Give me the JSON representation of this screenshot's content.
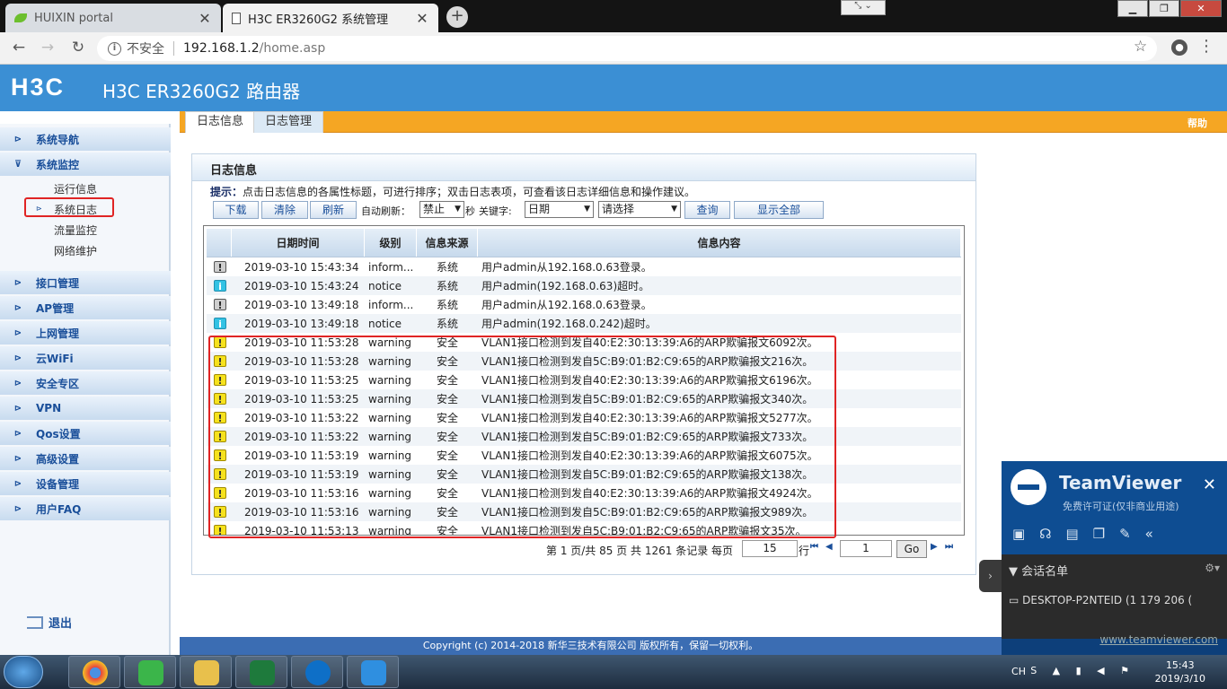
{
  "browser": {
    "tabs": [
      {
        "title": "HUIXIN portal",
        "icon": "leaf-icon"
      },
      {
        "title": "H3C ER3260G2 系统管理",
        "icon": "document-icon"
      }
    ],
    "new_tab": "+",
    "insecure_label": "不安全",
    "url_host": "192.168.1.2",
    "url_path": "/home.asp"
  },
  "app": {
    "logo": "H3C",
    "title": "H3C ER3260G2 路由器"
  },
  "sidebar": {
    "items": [
      {
        "label": "系统导航"
      },
      {
        "label": "系统监控"
      },
      {
        "label": "接口管理"
      },
      {
        "label": "AP管理"
      },
      {
        "label": "上网管理"
      },
      {
        "label": "云WiFi"
      },
      {
        "label": "安全专区"
      },
      {
        "label": "VPN"
      },
      {
        "label": "Qos设置"
      },
      {
        "label": "高级设置"
      },
      {
        "label": "设备管理"
      },
      {
        "label": "用户FAQ"
      }
    ],
    "subitems": [
      {
        "label": "运行信息"
      },
      {
        "label": "系统日志"
      },
      {
        "label": "流量监控"
      },
      {
        "label": "网络维护"
      }
    ],
    "logout": "退出"
  },
  "content_tabs": [
    {
      "label": "日志信息"
    },
    {
      "label": "日志管理"
    }
  ],
  "help": "帮助",
  "panel": {
    "title": "日志信息",
    "hint_label": "提示：",
    "hint_text": "点击日志信息的各属性标题，可进行排序；双击日志表项，可查看该日志详细信息和操作建议。"
  },
  "toolbar": {
    "download": "下载",
    "clear": "清除",
    "refresh": "刷新",
    "auto_refresh_label": "自动刷新：",
    "auto_refresh_value": "禁止",
    "seconds_label": "秒",
    "keyword_label": "关键字:",
    "keyword_field": "日期",
    "keyword_value": "请选择",
    "query": "查询",
    "show_all": "显示全部"
  },
  "table": {
    "headers": [
      "日期时间",
      "级别",
      "信息来源",
      "信息内容"
    ],
    "rows": [
      {
        "level_icon": "info",
        "datetime": "2019-03-10 15:43:34",
        "level": "inform...",
        "source": "系统",
        "content": "用户admin从192.168.0.63登录。"
      },
      {
        "level_icon": "notice",
        "datetime": "2019-03-10 15:43:24",
        "level": "notice",
        "source": "系统",
        "content": "用户admin(192.168.0.63)超时。"
      },
      {
        "level_icon": "info",
        "datetime": "2019-03-10 13:49:18",
        "level": "inform...",
        "source": "系统",
        "content": "用户admin从192.168.0.63登录。"
      },
      {
        "level_icon": "notice",
        "datetime": "2019-03-10 13:49:18",
        "level": "notice",
        "source": "系统",
        "content": "用户admin(192.168.0.242)超时。"
      },
      {
        "level_icon": "warning",
        "datetime": "2019-03-10 11:53:28",
        "level": "warning",
        "source": "安全",
        "content": "VLAN1接口检测到发自40:E2:30:13:39:A6的ARP欺骗报文6092次。"
      },
      {
        "level_icon": "warning",
        "datetime": "2019-03-10 11:53:28",
        "level": "warning",
        "source": "安全",
        "content": "VLAN1接口检测到发自5C:B9:01:B2:C9:65的ARP欺骗报文216次。"
      },
      {
        "level_icon": "warning",
        "datetime": "2019-03-10 11:53:25",
        "level": "warning",
        "source": "安全",
        "content": "VLAN1接口检测到发自40:E2:30:13:39:A6的ARP欺骗报文6196次。"
      },
      {
        "level_icon": "warning",
        "datetime": "2019-03-10 11:53:25",
        "level": "warning",
        "source": "安全",
        "content": "VLAN1接口检测到发自5C:B9:01:B2:C9:65的ARP欺骗报文340次。"
      },
      {
        "level_icon": "warning",
        "datetime": "2019-03-10 11:53:22",
        "level": "warning",
        "source": "安全",
        "content": "VLAN1接口检测到发自40:E2:30:13:39:A6的ARP欺骗报文5277次。"
      },
      {
        "level_icon": "warning",
        "datetime": "2019-03-10 11:53:22",
        "level": "warning",
        "source": "安全",
        "content": "VLAN1接口检测到发自5C:B9:01:B2:C9:65的ARP欺骗报文733次。"
      },
      {
        "level_icon": "warning",
        "datetime": "2019-03-10 11:53:19",
        "level": "warning",
        "source": "安全",
        "content": "VLAN1接口检测到发自40:E2:30:13:39:A6的ARP欺骗报文6075次。"
      },
      {
        "level_icon": "warning",
        "datetime": "2019-03-10 11:53:19",
        "level": "warning",
        "source": "安全",
        "content": "VLAN1接口检测到发自5C:B9:01:B2:C9:65的ARP欺骗报文138次。"
      },
      {
        "level_icon": "warning",
        "datetime": "2019-03-10 11:53:16",
        "level": "warning",
        "source": "安全",
        "content": "VLAN1接口检测到发自40:E2:30:13:39:A6的ARP欺骗报文4924次。"
      },
      {
        "level_icon": "warning",
        "datetime": "2019-03-10 11:53:16",
        "level": "warning",
        "source": "安全",
        "content": "VLAN1接口检测到发自5C:B9:01:B2:C9:65的ARP欺骗报文989次。"
      },
      {
        "level_icon": "warning",
        "datetime": "2019-03-10 11:53:13",
        "level": "warning",
        "source": "安全",
        "content": "VLAN1接口检测到发自5C:B9:01:B2:C9:65的ARP欺骗报文35次。"
      }
    ]
  },
  "pager": {
    "summary": "第 1 页/共 85 页 共 1261 条记录 每页",
    "per_page": "15",
    "rows_label": "行",
    "goto_value": "1",
    "go": "Go"
  },
  "footer": "Copyright (c) 2014-2018 新华三技术有限公司 版权所有，保留一切权利。",
  "teamviewer": {
    "brand": "TeamViewer",
    "subtitle": "免费许可证(仅非商业用途)",
    "session_list": "会话名单",
    "session_entry": "DESKTOP-P2NTEID (1 179 206 (",
    "link": "www.teamviewer.com"
  },
  "taskbar": {
    "ime": "CH",
    "time": "15:43",
    "date": "2019/3/10"
  },
  "colors": {
    "header_blue": "#3b8fd4",
    "tab_orange": "#f5a623",
    "highlight_red": "#e02424",
    "warning_yellow": "#f6e21d",
    "notice_cyan": "#33c2e4"
  }
}
